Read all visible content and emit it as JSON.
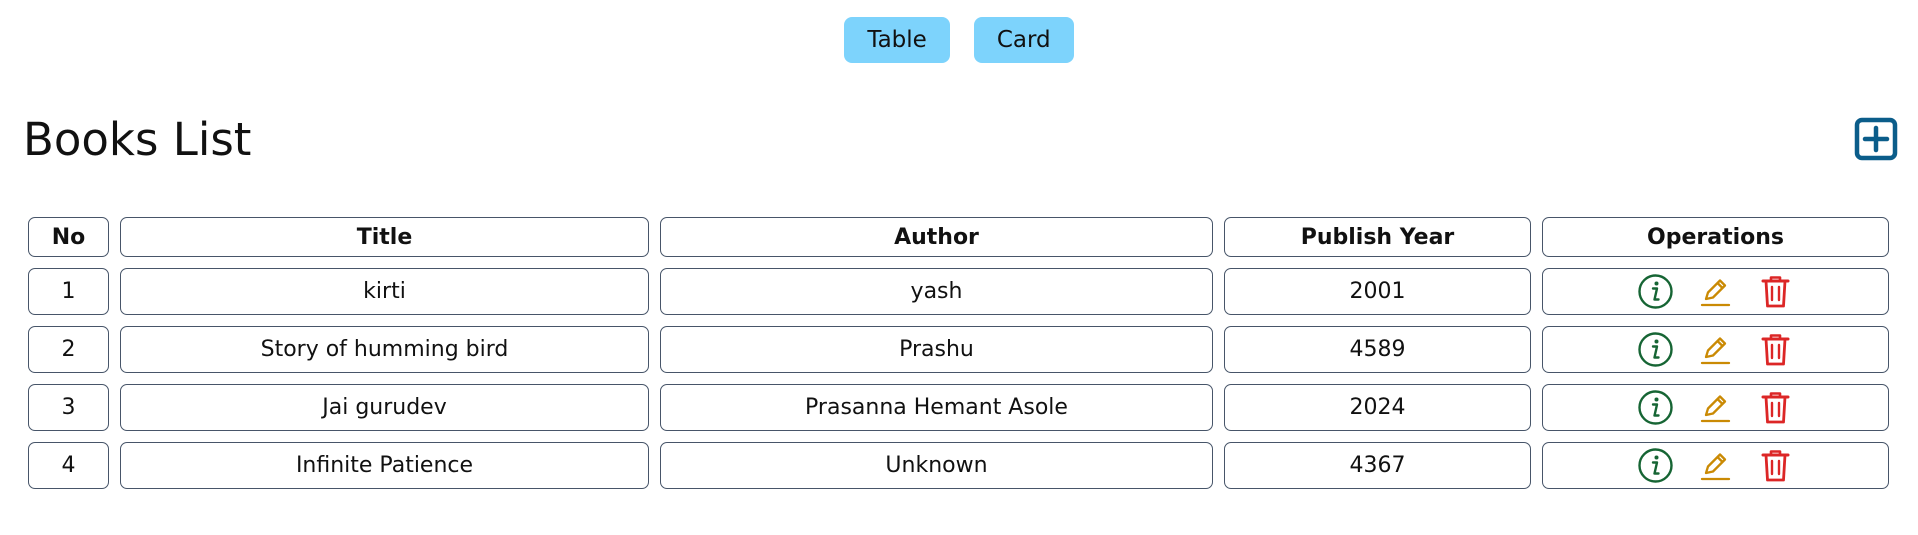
{
  "view_toggle": {
    "table_label": "Table",
    "card_label": "Card",
    "color": "#7dd3fc"
  },
  "header": {
    "title": "Books List",
    "add_icon": "plus-square-icon",
    "add_icon_color": "#0b5d8a"
  },
  "table": {
    "columns": [
      "No",
      "Title",
      "Author",
      "Publish Year",
      "Operations"
    ],
    "rows": [
      {
        "no": "1",
        "title": "kirti",
        "author": "yash",
        "year": "2001"
      },
      {
        "no": "2",
        "title": "Story of humming bird",
        "author": "Prashu",
        "year": "4589"
      },
      {
        "no": "3",
        "title": "Jai gurudev",
        "author": "Prasanna Hemant Asole",
        "year": "2024"
      },
      {
        "no": "4",
        "title": "Infinite Patience",
        "author": "Unknown",
        "year": "4367"
      }
    ],
    "operations": [
      {
        "icon": "info-circle-icon",
        "color": "#166534"
      },
      {
        "icon": "pencil-edit-icon",
        "color": "#ca8a04"
      },
      {
        "icon": "trash-icon",
        "color": "#dc2626"
      }
    ]
  }
}
